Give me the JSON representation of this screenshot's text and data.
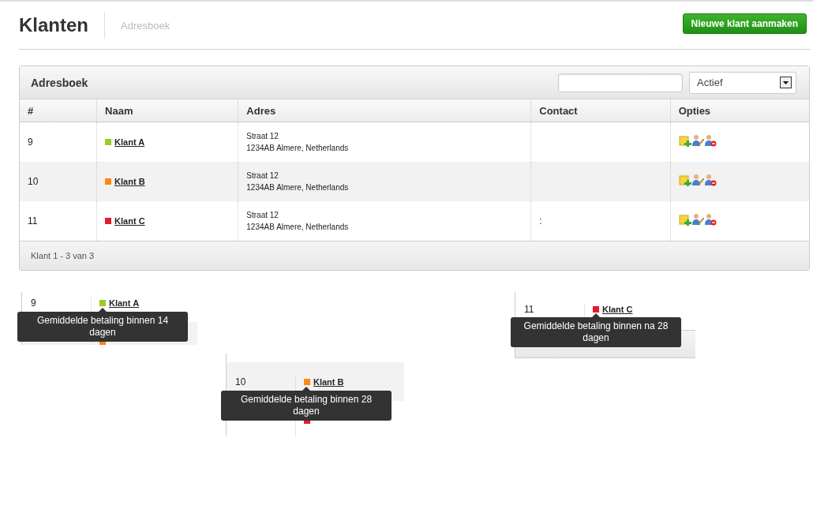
{
  "header": {
    "title": "Klanten",
    "breadcrumb": "Adresboek",
    "button": "Nieuwe klant aanmaken"
  },
  "panel": {
    "title": "Adresboek",
    "filter": "Actief",
    "columns": [
      "#",
      "Naam",
      "Adres",
      "Contact",
      "Opties"
    ],
    "rows": [
      {
        "number": "9",
        "name": "Klant A",
        "color": "#99cc22",
        "address": [
          "Straat 12",
          "1234AB Almere, Netherlands"
        ],
        "contact": ""
      },
      {
        "number": "10",
        "name": "Klant B",
        "color": "#ff8811",
        "address": [
          "Straat 12",
          "1234AB Almere, Netherlands"
        ],
        "contact": ""
      },
      {
        "number": "11",
        "name": "Klant C",
        "color": "#e8192c",
        "address": [
          "Straat 12",
          "1234AB Almere, Netherlands"
        ],
        "contact": ":"
      }
    ],
    "footer": "Klant 1 - 3 van 3"
  },
  "snippets": [
    {
      "rows": [
        {
          "number": "9",
          "name": "Klant A",
          "color": "#99cc22"
        },
        {
          "color": "#ff8811"
        }
      ],
      "tooltip": "Gemiddelde betaling binnen 14 dagen"
    },
    {
      "rows": [
        {
          "number": "10",
          "name": "Klant B",
          "color": "#ff8811"
        },
        {
          "color": "#e8192c"
        }
      ],
      "tooltip": "Gemiddelde betaling binnen 28 dagen"
    },
    {
      "rows": [
        {
          "number": "11",
          "name": "Klant C",
          "color": "#e8192c"
        }
      ],
      "tooltip": "Gemiddelde betaling binnen na 28 dagen"
    }
  ]
}
